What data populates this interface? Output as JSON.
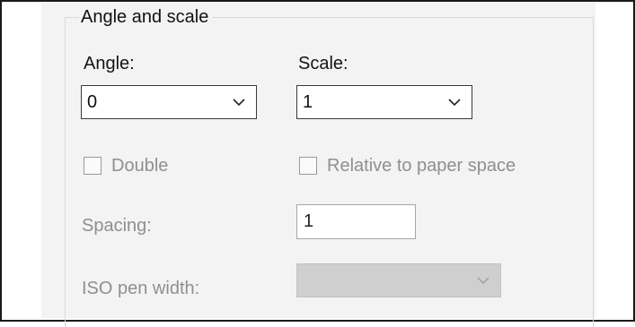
{
  "group": {
    "title": "Angle and scale"
  },
  "angle": {
    "label": "Angle:",
    "value": "0"
  },
  "scale": {
    "label": "Scale:",
    "value": "1"
  },
  "double": {
    "label": "Double",
    "checked": false
  },
  "relative": {
    "label": "Relative to paper space",
    "checked": false
  },
  "spacing": {
    "label": "Spacing:",
    "value": "1"
  },
  "iso_pen_width": {
    "label": "ISO pen width:",
    "value": ""
  },
  "icons": {
    "dropdown": "chevron-down-icon"
  },
  "colors": {
    "disabled_text": "#8f8f8f",
    "disabled_fill": "#cfcfcf",
    "panel_bg": "#f3f3f3"
  }
}
